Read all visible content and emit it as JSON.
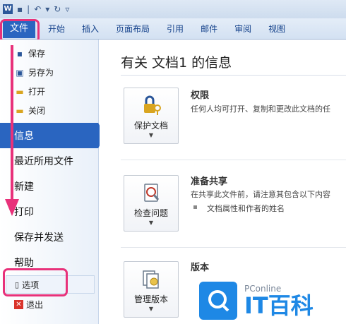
{
  "quick_access": {
    "app_icon": "W",
    "sep": "|"
  },
  "ribbon": {
    "file_tab": "文件",
    "tabs": [
      "开始",
      "插入",
      "页面布局",
      "引用",
      "邮件",
      "审阅",
      "视图"
    ]
  },
  "backstage": {
    "small_top": [
      {
        "label": "保存",
        "icon": "save-icon"
      },
      {
        "label": "另存为",
        "icon": "save-as-icon"
      },
      {
        "label": "打开",
        "icon": "open-folder-icon"
      },
      {
        "label": "关闭",
        "icon": "close-folder-icon"
      }
    ],
    "big_items": [
      "信息",
      "最近所用文件",
      "新建",
      "打印",
      "保存并发送",
      "帮助"
    ],
    "options": "选项",
    "exit": "退出"
  },
  "info": {
    "title": "有关 文档1 的信息",
    "sections": [
      {
        "button": "保护文档",
        "icon": "lock-key-icon",
        "heading": "权限",
        "desc": "任何人均可打开、复制和更改此文档的任"
      },
      {
        "button": "检查问题",
        "icon": "inspect-doc-icon",
        "heading": "准备共享",
        "desc": "在共享此文件前，请注意其包含以下内容",
        "bullet": "文档属性和作者的姓名"
      },
      {
        "button": "管理版本",
        "icon": "versions-icon",
        "heading": "版本",
        "desc": ""
      }
    ]
  },
  "watermark": {
    "brand": "PConline",
    "logo_text": "IT百科"
  },
  "colors": {
    "accent": "#2a65c0",
    "highlight": "#e8317a",
    "ribbon": "#dfe9f5"
  }
}
